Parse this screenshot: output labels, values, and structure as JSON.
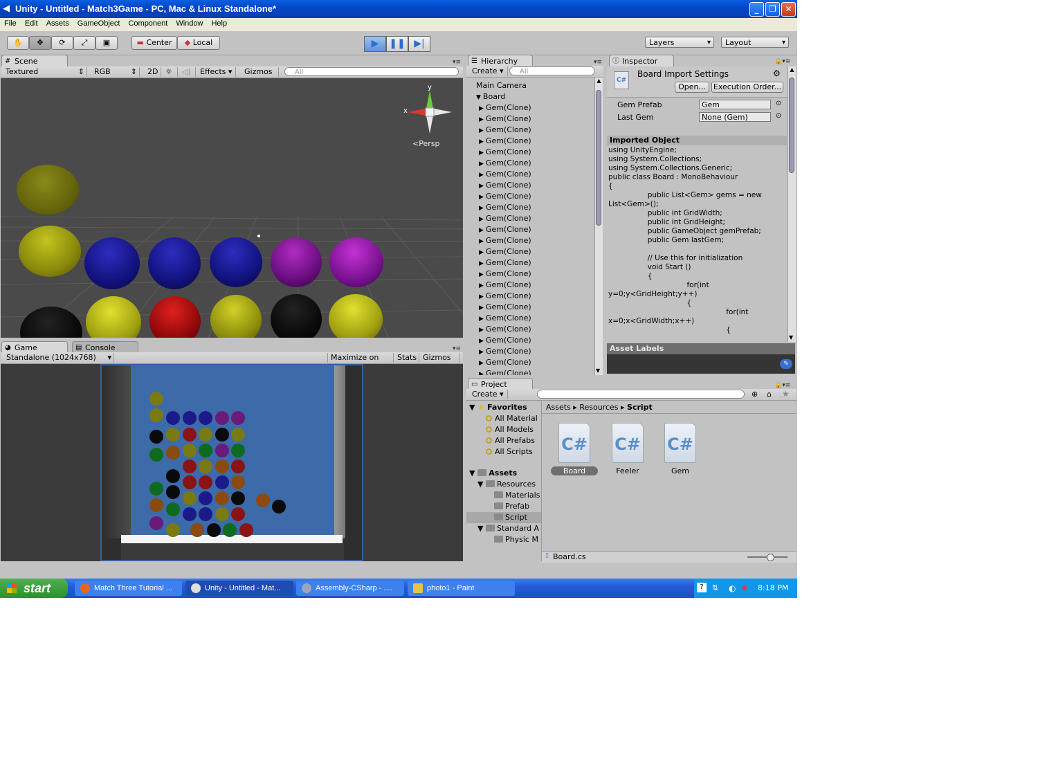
{
  "window": {
    "title": "Unity - Untitled - Match3Game - PC, Mac & Linux Standalone*"
  },
  "menu": [
    "File",
    "Edit",
    "Assets",
    "GameObject",
    "Component",
    "Window",
    "Help"
  ],
  "toolbar": {
    "center": "Center",
    "local": "Local",
    "layers": "Layers",
    "layout": "Layout"
  },
  "scene": {
    "tab": "Scene",
    "shading": "Textured",
    "rgb": "RGB",
    "mode2d": "2D",
    "effects": "Effects",
    "gizmos": "Gizmos",
    "search_placeholder": "All",
    "persp": "Persp",
    "gizmo_y": "y",
    "gizmo_x": "x"
  },
  "game": {
    "tab": "Game",
    "console_tab": "Console",
    "resolution": "Standalone (1024x768)",
    "maximize": "Maximize on Play",
    "stats": "Stats",
    "gizmos": "Gizmos"
  },
  "hierarchy": {
    "tab": "Hierarchy",
    "create": "Create",
    "search_placeholder": "All",
    "items": [
      "Main Camera",
      "Board",
      "Gem(Clone)",
      "Gem(Clone)",
      "Gem(Clone)",
      "Gem(Clone)",
      "Gem(Clone)",
      "Gem(Clone)",
      "Gem(Clone)",
      "Gem(Clone)",
      "Gem(Clone)",
      "Gem(Clone)",
      "Gem(Clone)",
      "Gem(Clone)",
      "Gem(Clone)",
      "Gem(Clone)",
      "Gem(Clone)",
      "Gem(Clone)",
      "Gem(Clone)",
      "Gem(Clone)",
      "Gem(Clone)",
      "Gem(Clone)",
      "Gem(Clone)",
      "Gem(Clone)",
      "Gem(Clone)",
      "Gem(Clone)",
      "Gem(Clone)"
    ]
  },
  "inspector": {
    "tab": "Inspector",
    "title": "Board Import Settings",
    "open": "Open...",
    "execution_order": "Execution Order...",
    "fields": [
      {
        "label": "Gem Prefab",
        "value": "Gem"
      },
      {
        "label": "Last Gem",
        "value": "None (Gem)"
      }
    ],
    "imported_header": "Imported Object",
    "code": "using UnityEngine;\nusing System.Collections;\nusing System.Collections.Generic;\npublic class Board : MonoBehaviour\n{\n                 public List<Gem> gems = new\nList<Gem>();\n                 public int GridWidth;\n                 public int GridHeight;\n                 public GameObject gemPrefab;\n                 public Gem lastGem;\n\n                 // Use this for initialization\n                 void Start ()\n                 {\n                                  for(int\ny=0;y<GridHeight;y++)\n                                  {\n                                                   for(int\nx=0;x<GridWidth;x++)\n                                                   {",
    "asset_labels": "Asset Labels"
  },
  "project": {
    "tab": "Project",
    "create": "Create",
    "favorites_label": "Favorites",
    "favorites": [
      "All Material",
      "All Models",
      "All Prefabs",
      "All Scripts"
    ],
    "assets_label": "Assets",
    "tree": [
      "Resources",
      "Materials",
      "Prefab",
      "Script",
      "Standard A",
      "Physic M"
    ],
    "breadcrumb": [
      "Assets",
      "Resources",
      "Script"
    ],
    "files": [
      "Board",
      "Feeler",
      "Gem"
    ],
    "selected_file": "Board.cs",
    "cs_glyph": "C#"
  },
  "taskbar": {
    "start": "start",
    "tasks": [
      "Match Three Tutorial ...",
      "Unity - Untitled - Mat...",
      "Assembly-CSharp - ....",
      "photo1 - Paint"
    ],
    "clock": "8:18 PM"
  }
}
